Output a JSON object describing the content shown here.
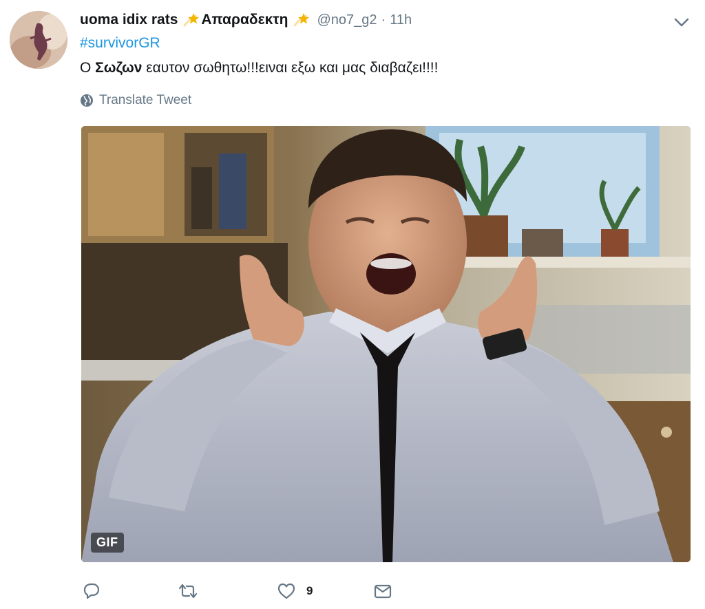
{
  "tweet": {
    "fullname_part1": "uoma idix rats",
    "fullname_part2": "Απαραδεκτη",
    "screen_name": "@no7_g2",
    "separator": "·",
    "time": "11h",
    "hashtag": "#survivorGR",
    "text_prefix": "Ο ",
    "text_bold": "Σωζων",
    "text_suffix": " εαυτον σωθητω!!!ειναι εξω και μας διαβαζει!!!!",
    "translate_label": "Translate Tweet",
    "media_badge": "GIF",
    "like_count": "9"
  },
  "icons": {
    "avatar": "avatar",
    "name_emoji": "shooting-star-icon",
    "menu": "chevron-down-icon",
    "translate": "globe-icon",
    "reply": "reply-icon",
    "retweet": "retweet-icon",
    "like": "heart-icon",
    "message": "envelope-icon"
  },
  "colors": {
    "link": "#1b95e0",
    "secondary_text": "#657786",
    "primary_text": "#14171a",
    "star": "#f4b400"
  }
}
